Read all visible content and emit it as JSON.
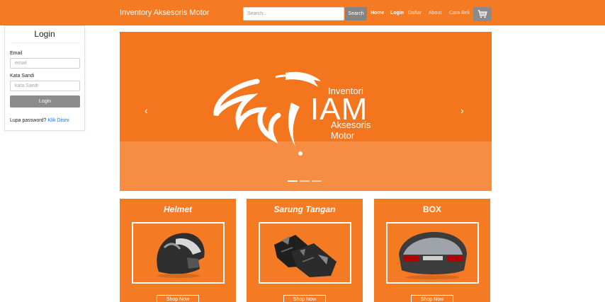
{
  "navbar": {
    "brand": "Inventory Aksesoris Motor",
    "search_placeholder": "Search..",
    "search_button": "Search",
    "links": [
      "Home",
      "Login",
      "Daftar",
      "About",
      "Cara Beli"
    ],
    "cart_icon": "cart-icon"
  },
  "login": {
    "title": "Login",
    "email_label": "Email",
    "email_placeholder": "email",
    "password_label": "Kata Sandi",
    "password_placeholder": "kata Sandi",
    "button": "Login",
    "forgot_text": "Lupa password?",
    "forgot_link": "Klik Disini"
  },
  "carousel": {
    "prev_icon": "‹",
    "next_icon": "›",
    "logo_line1": "Inventori",
    "logo_letters": "IAM",
    "logo_line2": "Aksesoris Motor",
    "slide_count": 3,
    "active_slide": 1
  },
  "products": [
    {
      "title": "Helmet",
      "button": "Shop Now"
    },
    {
      "title": "Sarung Tangan",
      "button": "Shop Now"
    },
    {
      "title": "BOX",
      "button": "Shop Now"
    }
  ],
  "colors": {
    "brand_orange": "#f47a23",
    "button_gray": "#8c8c8c",
    "link_blue": "#1a73e8"
  }
}
